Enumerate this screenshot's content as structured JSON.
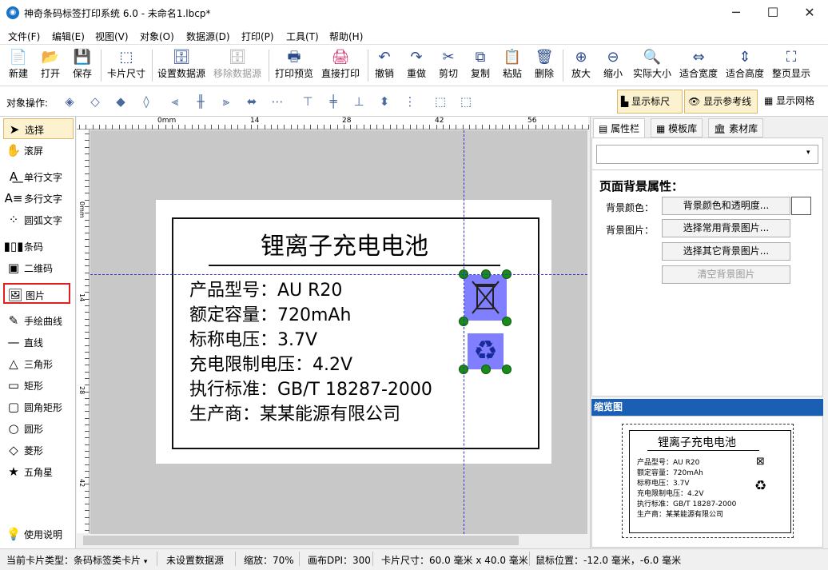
{
  "window": {
    "title": "神奇条码标签打印系统 6.0 - 未命名1.lbcp*",
    "app_icon": "app-logo-icon"
  },
  "menu": [
    "文件(F)",
    "编辑(E)",
    "视图(V)",
    "对象(O)",
    "数据源(D)",
    "打印(P)",
    "工具(T)",
    "帮助(H)"
  ],
  "toolbar": {
    "new": "新建",
    "open": "打开",
    "save": "保存",
    "card_size": "卡片尺寸",
    "set_datasource": "设置数据源",
    "remove_datasource": "移除数据源",
    "print_preview": "打印预览",
    "direct_print": "直接打印",
    "undo": "撤销",
    "redo": "重做",
    "cut": "剪切",
    "copy": "复制",
    "paste": "粘贴",
    "delete": "删除",
    "zoom_in": "放大",
    "zoom_out": "缩小",
    "actual_size": "实际大小",
    "fit_width": "适合宽度",
    "fit_height": "适合高度",
    "fit_page": "整页显示"
  },
  "toolbar2": {
    "object_ops": "对象操作:",
    "show_ruler": "显示标尺",
    "show_guides": "显示参考线",
    "show_grid": "显示网格"
  },
  "tools": [
    "选择",
    "滚屏",
    "单行文字",
    "多行文字",
    "圆弧文字",
    "条码",
    "二维码",
    "图片",
    "手绘曲线",
    "直线",
    "三角形",
    "矩形",
    "圆角矩形",
    "圆形",
    "菱形",
    "五角星",
    "使用说明"
  ],
  "ruler_top": [
    "0mm",
    "14",
    "28",
    "42",
    "56"
  ],
  "ruler_left": [
    "0mm",
    "14",
    "28",
    "42"
  ],
  "label": {
    "title": "锂离子充电电池",
    "rows": [
      "产品型号：AU R20",
      "额定容量：720mAh",
      "标称电压：3.7V",
      "充电限制电压：4.2V",
      "执行标准：GB/T 18287-2000",
      "生产商：某某能源有限公司"
    ]
  },
  "right_panel": {
    "tabs": [
      "属性栏",
      "模板库",
      "素材库"
    ],
    "section_title": "页面背景属性：",
    "bg_color_label": "背景颜色：",
    "bg_color_btn": "背景颜色和透明度...",
    "bg_image_label": "背景图片：",
    "choose_common_btn": "选择常用背景图片...",
    "choose_other_btn": "选择其它背景图片...",
    "clear_btn": "清空背景图片",
    "thumbnail_header": "缩览图"
  },
  "status": {
    "card_type": "当前卡片类型：条码标签类卡片",
    "datasource": "未设置数据源",
    "zoom": "缩放：70%",
    "dpi": "画布DPI：300",
    "card_size": "卡片尺寸：60.0 毫米 x 40.0 毫米",
    "mouse_pos": "鼠标位置：-12.0 毫米，-6.0 毫米"
  },
  "colors": {
    "accent": "#1a5fb4",
    "selection": "#7f7fff",
    "handle": "#1a8a1a",
    "highlight_border": "#e02020"
  }
}
